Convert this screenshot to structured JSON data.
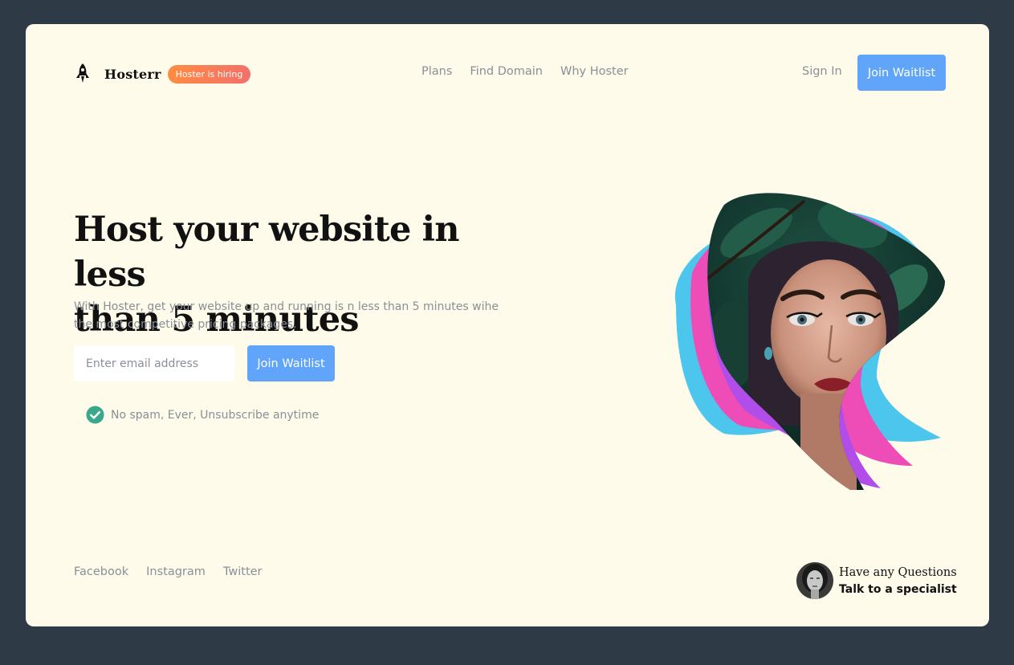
{
  "header": {
    "brand": "Hosterr",
    "badge": "Hoster is hiring",
    "nav": [
      "Plans",
      "Find Domain",
      "Why Hoster"
    ],
    "signin": "Sign In",
    "cta": "Join Waitlist"
  },
  "hero": {
    "headline_line1": "Host your website in less",
    "headline_line2": "than 5 minutes",
    "subtext": "With Hoster, get your website up and running is n less than 5 minutes wihe the most competitive pricing packages.",
    "email_placeholder": "Enter email address",
    "cta": "Join Waitlist",
    "note": "No spam, Ever, Unsubscribe anytime"
  },
  "footer": {
    "social": [
      "Facebook",
      "Instagram",
      "Twitter"
    ],
    "help_question": "Have any Questions",
    "help_cta": "Talk to a specialist"
  },
  "colors": {
    "background": "#2e3a45",
    "card": "#fffbea",
    "accent": "#60a5fa",
    "badge_start": "#ff8c42",
    "badge_end": "#f2706a",
    "check": "#3aa88a",
    "wave_cyan": "#4cc6ec",
    "wave_pink": "#ee4cb7",
    "wave_purple": "#b14ee9"
  },
  "icons": {
    "logo": "rocket-icon",
    "note": "check-circle-icon"
  }
}
